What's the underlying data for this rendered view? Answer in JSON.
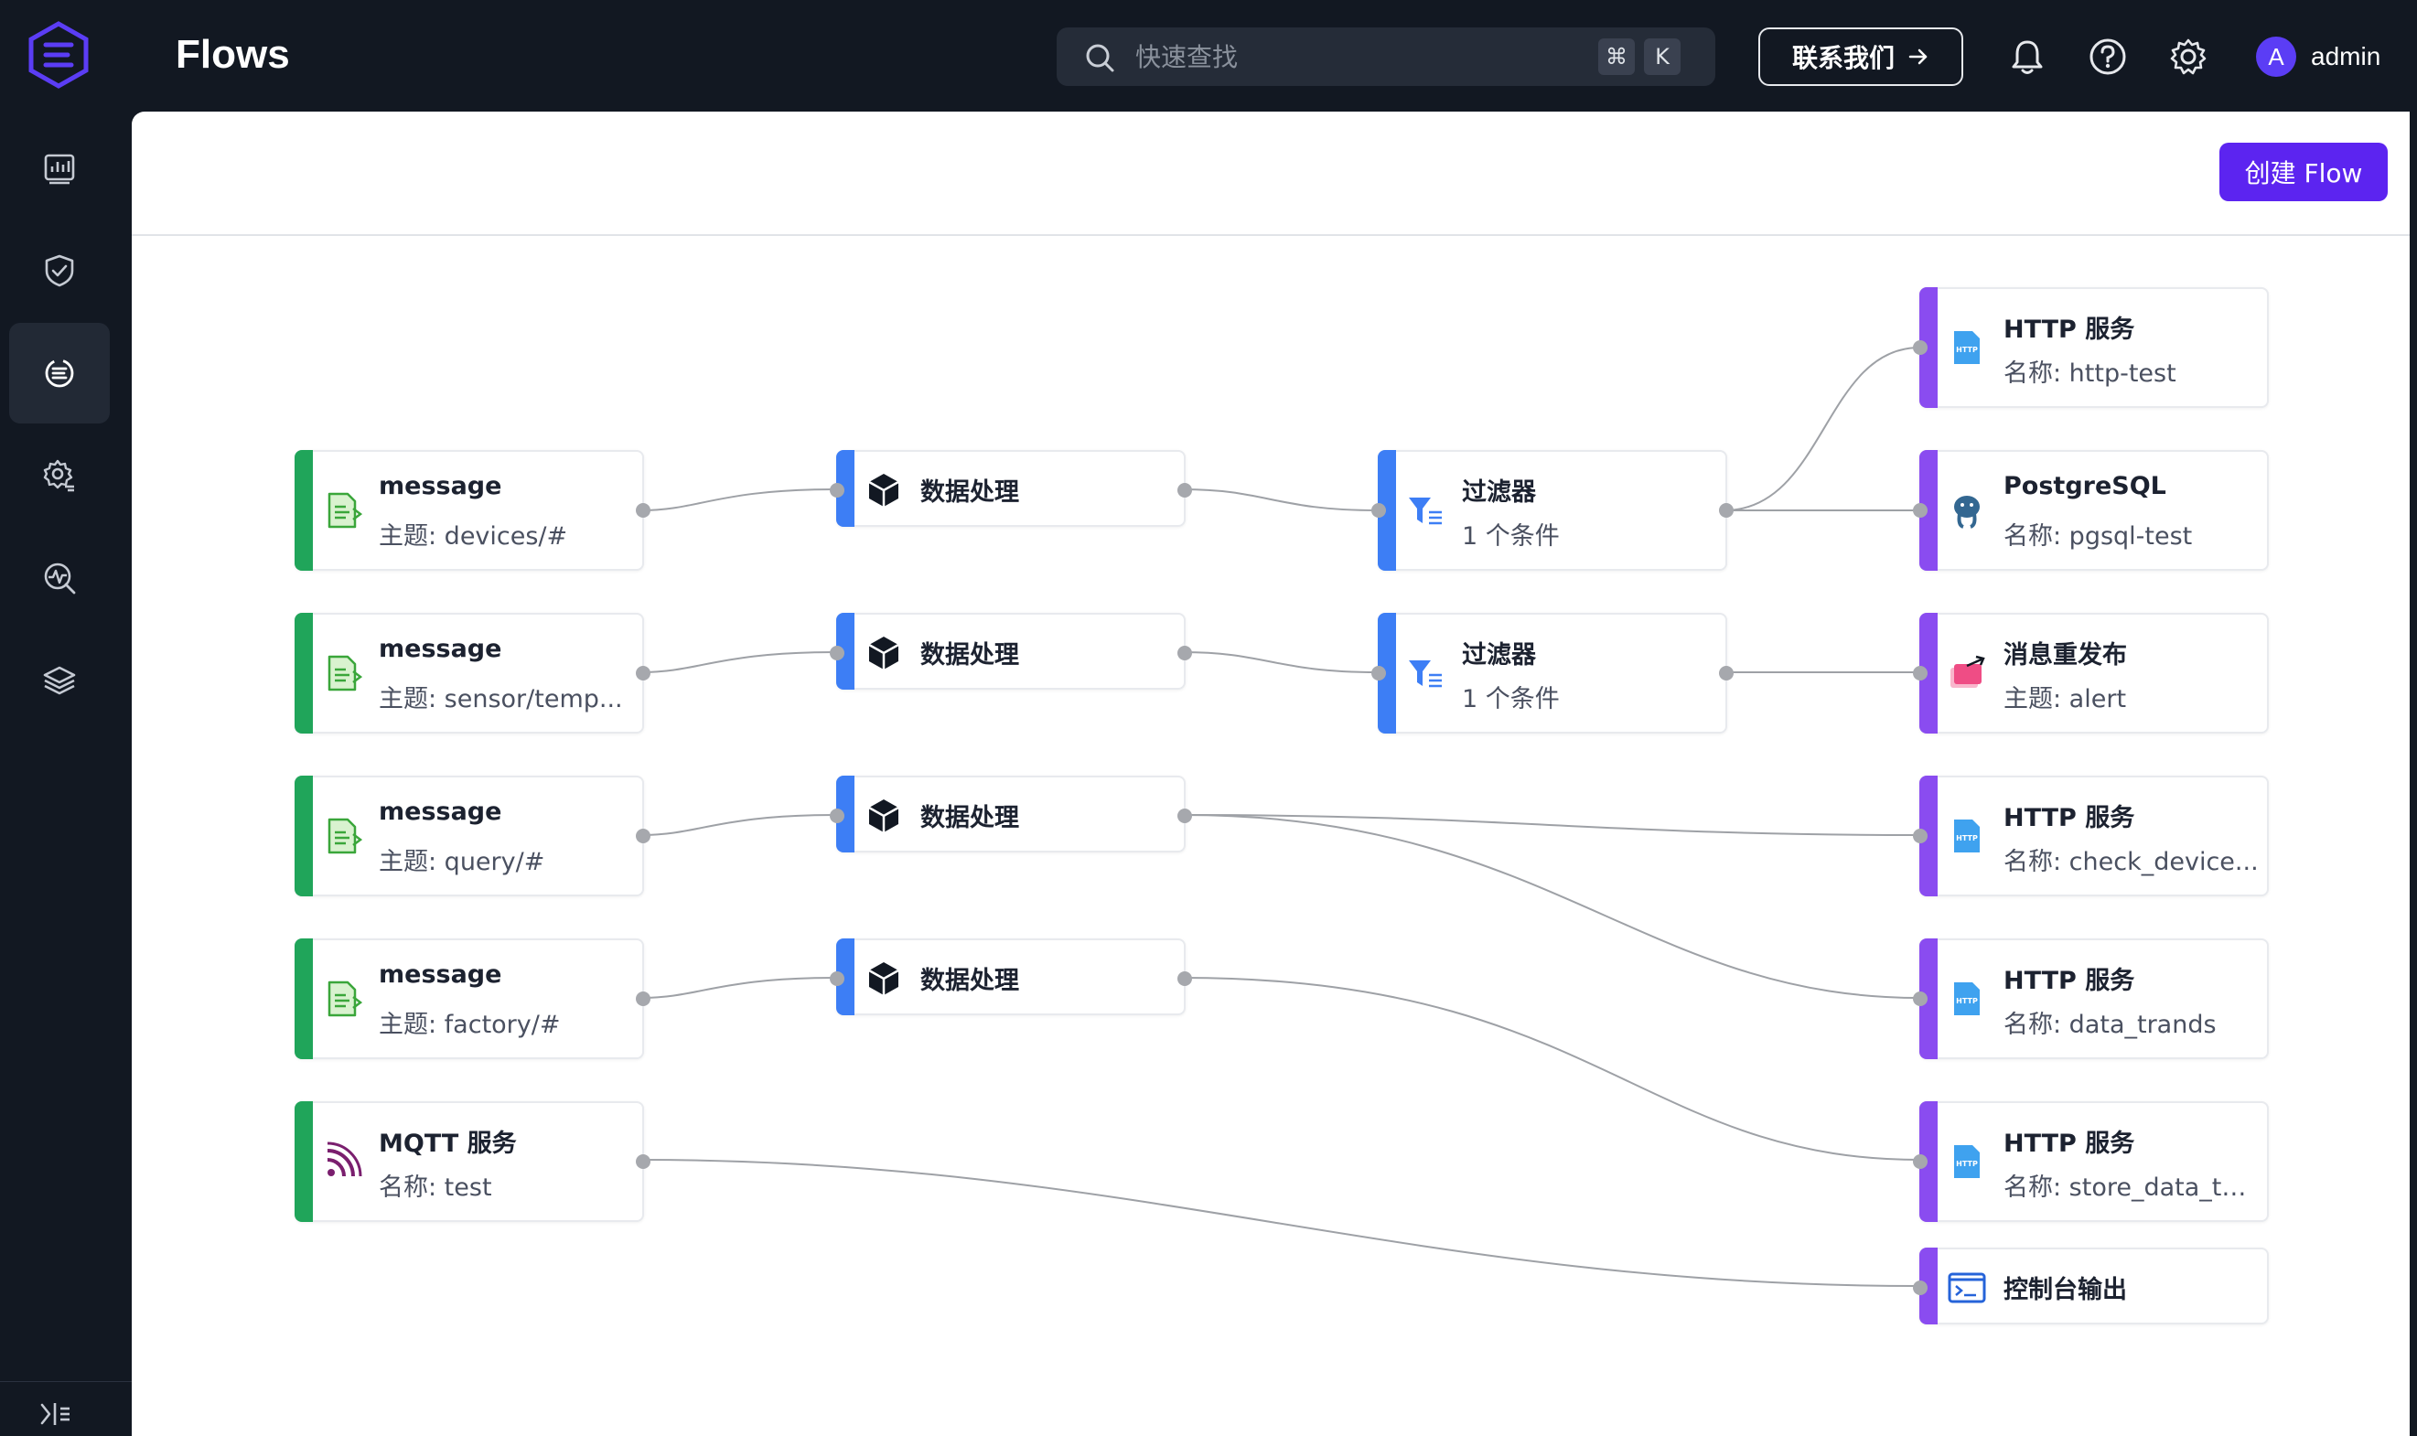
{
  "header": {
    "title": "Flows",
    "search_placeholder": "快速查找",
    "shortcut_cmd": "⌘",
    "shortcut_key": "K",
    "contact_label": "联系我们",
    "avatar_letter": "A",
    "username": "admin"
  },
  "sidebar": {
    "items": [
      {
        "icon": "dashboard-icon"
      },
      {
        "icon": "shield-icon"
      },
      {
        "icon": "flows-icon",
        "active": true
      },
      {
        "icon": "settings-gear-icon"
      },
      {
        "icon": "diagnose-icon"
      },
      {
        "icon": "layers-icon"
      }
    ]
  },
  "toolbar": {
    "create_label": "创建 Flow"
  },
  "flow": {
    "sources": [
      {
        "title": "message",
        "subtitle": "主题: devices/#"
      },
      {
        "title": "message",
        "subtitle": "主题: sensor/temp..."
      },
      {
        "title": "message",
        "subtitle": "主题: query/#"
      },
      {
        "title": "message",
        "subtitle": "主题: factory/#"
      },
      {
        "title": "MQTT 服务",
        "subtitle": "名称: test"
      }
    ],
    "processors": [
      {
        "title": "数据处理"
      },
      {
        "title": "数据处理"
      },
      {
        "title": "数据处理"
      },
      {
        "title": "数据处理"
      }
    ],
    "filters": [
      {
        "title": "过滤器",
        "subtitle": "1 个条件"
      },
      {
        "title": "过滤器",
        "subtitle": "1 个条件"
      }
    ],
    "sinks": [
      {
        "title": "HTTP 服务",
        "subtitle": "名称: http-test"
      },
      {
        "title": "PostgreSQL",
        "subtitle": "名称: pgsql-test"
      },
      {
        "title": "消息重发布",
        "subtitle": "主题: alert"
      },
      {
        "title": "HTTP 服务",
        "subtitle": "名称: check_device..."
      },
      {
        "title": "HTTP 服务",
        "subtitle": "名称: data_trands"
      },
      {
        "title": "HTTP 服务",
        "subtitle": "名称: store_data_to..."
      },
      {
        "title": "控制台输出"
      }
    ]
  },
  "colors": {
    "source": "#20a55a",
    "processor": "#3d7ef5",
    "sink": "#8a4cf0",
    "primary_button": "#5c24f0"
  }
}
